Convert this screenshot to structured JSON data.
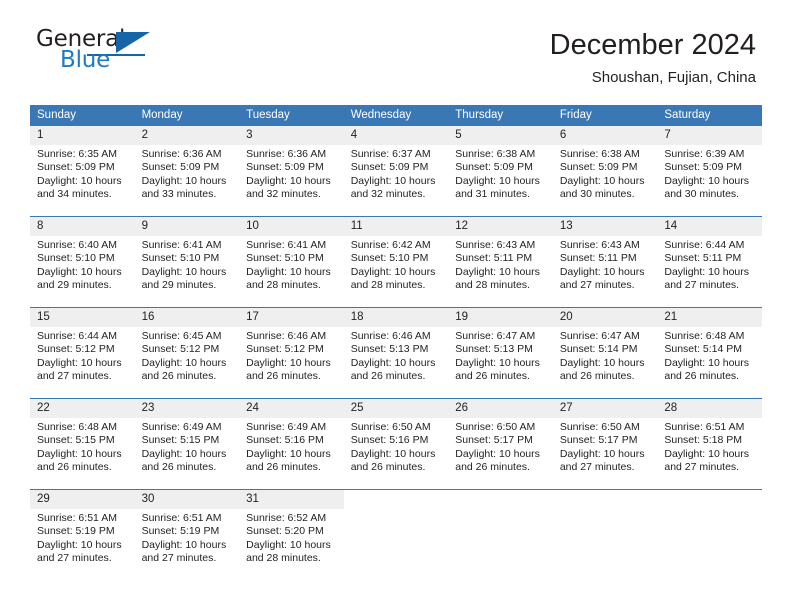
{
  "brand": {
    "word_one": "General",
    "word_two": "Blue",
    "logo_icon": "general-blue-triangle-logo"
  },
  "header": {
    "title": "December 2024",
    "subtitle": "Shoushan, Fujian, China"
  },
  "colors": {
    "header_blue": "#3a77b5",
    "brand_blue": "#1f7ac4",
    "daynum_band": "#efefef",
    "text": "#231f20"
  },
  "calendar": {
    "weekday_headers": [
      "Sunday",
      "Monday",
      "Tuesday",
      "Wednesday",
      "Thursday",
      "Friday",
      "Saturday"
    ],
    "weeks": [
      [
        {
          "day": "1",
          "sunrise": "Sunrise: 6:35 AM",
          "sunset": "Sunset: 5:09 PM",
          "daylight_line1": "Daylight: 10 hours",
          "daylight_line2": "and 34 minutes."
        },
        {
          "day": "2",
          "sunrise": "Sunrise: 6:36 AM",
          "sunset": "Sunset: 5:09 PM",
          "daylight_line1": "Daylight: 10 hours",
          "daylight_line2": "and 33 minutes."
        },
        {
          "day": "3",
          "sunrise": "Sunrise: 6:36 AM",
          "sunset": "Sunset: 5:09 PM",
          "daylight_line1": "Daylight: 10 hours",
          "daylight_line2": "and 32 minutes."
        },
        {
          "day": "4",
          "sunrise": "Sunrise: 6:37 AM",
          "sunset": "Sunset: 5:09 PM",
          "daylight_line1": "Daylight: 10 hours",
          "daylight_line2": "and 32 minutes."
        },
        {
          "day": "5",
          "sunrise": "Sunrise: 6:38 AM",
          "sunset": "Sunset: 5:09 PM",
          "daylight_line1": "Daylight: 10 hours",
          "daylight_line2": "and 31 minutes."
        },
        {
          "day": "6",
          "sunrise": "Sunrise: 6:38 AM",
          "sunset": "Sunset: 5:09 PM",
          "daylight_line1": "Daylight: 10 hours",
          "daylight_line2": "and 30 minutes."
        },
        {
          "day": "7",
          "sunrise": "Sunrise: 6:39 AM",
          "sunset": "Sunset: 5:09 PM",
          "daylight_line1": "Daylight: 10 hours",
          "daylight_line2": "and 30 minutes."
        }
      ],
      [
        {
          "day": "8",
          "sunrise": "Sunrise: 6:40 AM",
          "sunset": "Sunset: 5:10 PM",
          "daylight_line1": "Daylight: 10 hours",
          "daylight_line2": "and 29 minutes."
        },
        {
          "day": "9",
          "sunrise": "Sunrise: 6:41 AM",
          "sunset": "Sunset: 5:10 PM",
          "daylight_line1": "Daylight: 10 hours",
          "daylight_line2": "and 29 minutes."
        },
        {
          "day": "10",
          "sunrise": "Sunrise: 6:41 AM",
          "sunset": "Sunset: 5:10 PM",
          "daylight_line1": "Daylight: 10 hours",
          "daylight_line2": "and 28 minutes."
        },
        {
          "day": "11",
          "sunrise": "Sunrise: 6:42 AM",
          "sunset": "Sunset: 5:10 PM",
          "daylight_line1": "Daylight: 10 hours",
          "daylight_line2": "and 28 minutes."
        },
        {
          "day": "12",
          "sunrise": "Sunrise: 6:43 AM",
          "sunset": "Sunset: 5:11 PM",
          "daylight_line1": "Daylight: 10 hours",
          "daylight_line2": "and 28 minutes."
        },
        {
          "day": "13",
          "sunrise": "Sunrise: 6:43 AM",
          "sunset": "Sunset: 5:11 PM",
          "daylight_line1": "Daylight: 10 hours",
          "daylight_line2": "and 27 minutes."
        },
        {
          "day": "14",
          "sunrise": "Sunrise: 6:44 AM",
          "sunset": "Sunset: 5:11 PM",
          "daylight_line1": "Daylight: 10 hours",
          "daylight_line2": "and 27 minutes."
        }
      ],
      [
        {
          "day": "15",
          "sunrise": "Sunrise: 6:44 AM",
          "sunset": "Sunset: 5:12 PM",
          "daylight_line1": "Daylight: 10 hours",
          "daylight_line2": "and 27 minutes."
        },
        {
          "day": "16",
          "sunrise": "Sunrise: 6:45 AM",
          "sunset": "Sunset: 5:12 PM",
          "daylight_line1": "Daylight: 10 hours",
          "daylight_line2": "and 26 minutes."
        },
        {
          "day": "17",
          "sunrise": "Sunrise: 6:46 AM",
          "sunset": "Sunset: 5:12 PM",
          "daylight_line1": "Daylight: 10 hours",
          "daylight_line2": "and 26 minutes."
        },
        {
          "day": "18",
          "sunrise": "Sunrise: 6:46 AM",
          "sunset": "Sunset: 5:13 PM",
          "daylight_line1": "Daylight: 10 hours",
          "daylight_line2": "and 26 minutes."
        },
        {
          "day": "19",
          "sunrise": "Sunrise: 6:47 AM",
          "sunset": "Sunset: 5:13 PM",
          "daylight_line1": "Daylight: 10 hours",
          "daylight_line2": "and 26 minutes."
        },
        {
          "day": "20",
          "sunrise": "Sunrise: 6:47 AM",
          "sunset": "Sunset: 5:14 PM",
          "daylight_line1": "Daylight: 10 hours",
          "daylight_line2": "and 26 minutes."
        },
        {
          "day": "21",
          "sunrise": "Sunrise: 6:48 AM",
          "sunset": "Sunset: 5:14 PM",
          "daylight_line1": "Daylight: 10 hours",
          "daylight_line2": "and 26 minutes."
        }
      ],
      [
        {
          "day": "22",
          "sunrise": "Sunrise: 6:48 AM",
          "sunset": "Sunset: 5:15 PM",
          "daylight_line1": "Daylight: 10 hours",
          "daylight_line2": "and 26 minutes."
        },
        {
          "day": "23",
          "sunrise": "Sunrise: 6:49 AM",
          "sunset": "Sunset: 5:15 PM",
          "daylight_line1": "Daylight: 10 hours",
          "daylight_line2": "and 26 minutes."
        },
        {
          "day": "24",
          "sunrise": "Sunrise: 6:49 AM",
          "sunset": "Sunset: 5:16 PM",
          "daylight_line1": "Daylight: 10 hours",
          "daylight_line2": "and 26 minutes."
        },
        {
          "day": "25",
          "sunrise": "Sunrise: 6:50 AM",
          "sunset": "Sunset: 5:16 PM",
          "daylight_line1": "Daylight: 10 hours",
          "daylight_line2": "and 26 minutes."
        },
        {
          "day": "26",
          "sunrise": "Sunrise: 6:50 AM",
          "sunset": "Sunset: 5:17 PM",
          "daylight_line1": "Daylight: 10 hours",
          "daylight_line2": "and 26 minutes."
        },
        {
          "day": "27",
          "sunrise": "Sunrise: 6:50 AM",
          "sunset": "Sunset: 5:17 PM",
          "daylight_line1": "Daylight: 10 hours",
          "daylight_line2": "and 27 minutes."
        },
        {
          "day": "28",
          "sunrise": "Sunrise: 6:51 AM",
          "sunset": "Sunset: 5:18 PM",
          "daylight_line1": "Daylight: 10 hours",
          "daylight_line2": "and 27 minutes."
        }
      ],
      [
        {
          "day": "29",
          "sunrise": "Sunrise: 6:51 AM",
          "sunset": "Sunset: 5:19 PM",
          "daylight_line1": "Daylight: 10 hours",
          "daylight_line2": "and 27 minutes."
        },
        {
          "day": "30",
          "sunrise": "Sunrise: 6:51 AM",
          "sunset": "Sunset: 5:19 PM",
          "daylight_line1": "Daylight: 10 hours",
          "daylight_line2": "and 27 minutes."
        },
        {
          "day": "31",
          "sunrise": "Sunrise: 6:52 AM",
          "sunset": "Sunset: 5:20 PM",
          "daylight_line1": "Daylight: 10 hours",
          "daylight_line2": "and 28 minutes."
        },
        {
          "day": "",
          "sunrise": "",
          "sunset": "",
          "daylight_line1": "",
          "daylight_line2": ""
        },
        {
          "day": "",
          "sunrise": "",
          "sunset": "",
          "daylight_line1": "",
          "daylight_line2": ""
        },
        {
          "day": "",
          "sunrise": "",
          "sunset": "",
          "daylight_line1": "",
          "daylight_line2": ""
        },
        {
          "day": "",
          "sunrise": "",
          "sunset": "",
          "daylight_line1": "",
          "daylight_line2": ""
        }
      ]
    ]
  }
}
